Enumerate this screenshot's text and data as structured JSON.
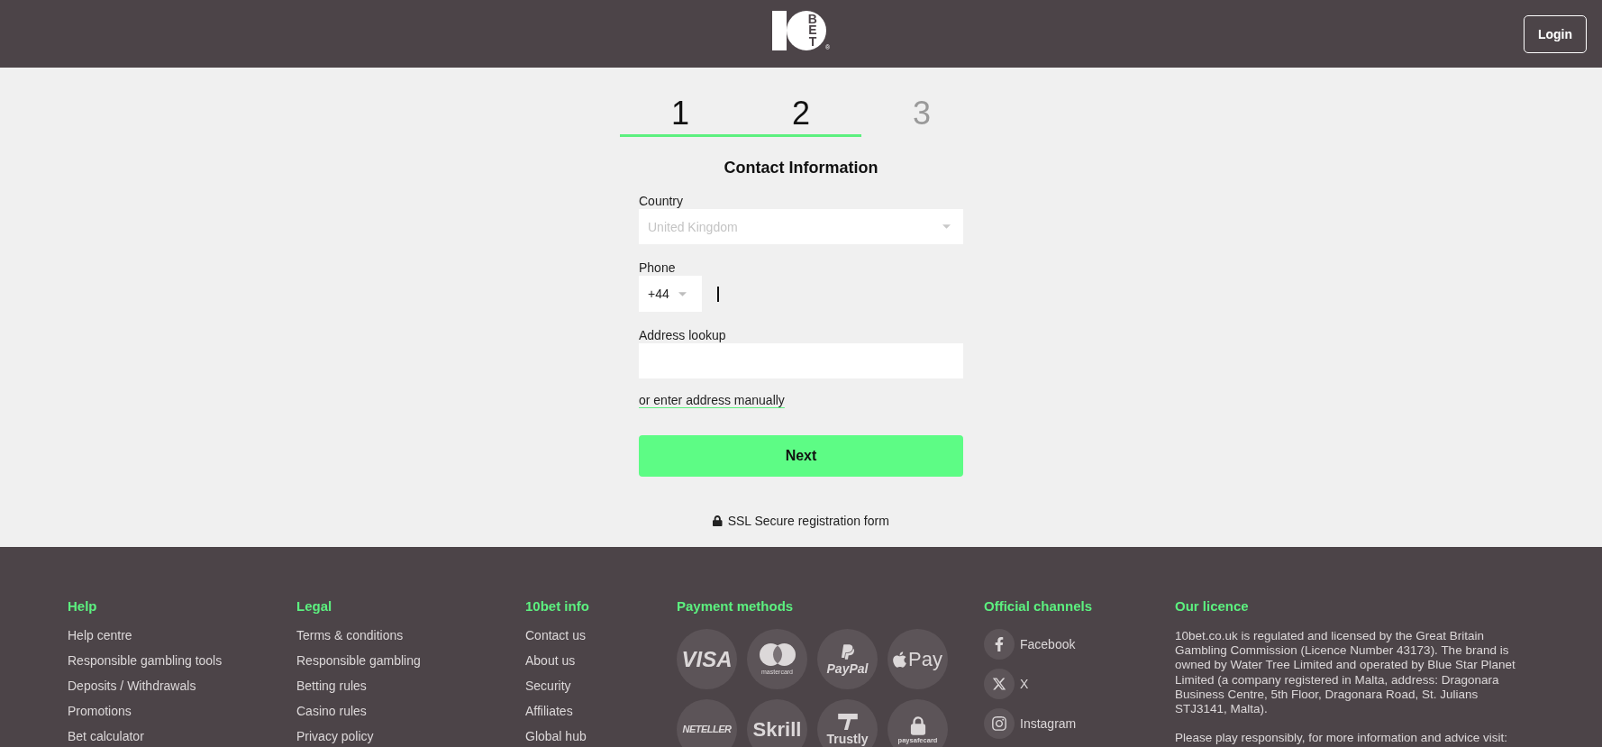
{
  "header": {
    "logo": {
      "text": "BET",
      "mark": "®"
    },
    "login_button": "Login"
  },
  "steps": [
    {
      "label": "1",
      "reached": true
    },
    {
      "label": "2",
      "reached": true
    },
    {
      "label": "3",
      "reached": false
    }
  ],
  "form": {
    "title": "Contact Information",
    "country": {
      "label": "Country",
      "value": "United Kingdom",
      "disabled": true
    },
    "phone": {
      "label": "Phone",
      "prefix": "+44",
      "focused": true
    },
    "address": {
      "label": "Address lookup"
    },
    "manual_link": "or enter address manually",
    "submit_button": "Next",
    "secure_note": "SSL Secure registration form"
  },
  "footer": {
    "link_columns": [
      {
        "heading": "Help",
        "links": [
          "Help centre",
          "Responsible gambling tools",
          "Deposits / Withdrawals",
          "Promotions",
          "Bet calculator"
        ]
      },
      {
        "heading": "Legal",
        "links": [
          "Terms & conditions",
          "Responsible gambling",
          "Betting rules",
          "Casino rules",
          "Privacy policy"
        ]
      },
      {
        "heading": "10bet info",
        "links": [
          "Contact us",
          "About us",
          "Security",
          "Affiliates",
          "Global hub"
        ]
      }
    ],
    "payment_methods": {
      "heading": "Payment methods",
      "items": [
        {
          "label": "VISA",
          "kind": "italic"
        },
        {
          "label": "mastercard",
          "kind": "rings"
        },
        {
          "label": "PayPal",
          "kind": "p-mark"
        },
        {
          "label": "Pay",
          "kind": "apple"
        },
        {
          "label": "NETELLER",
          "kind": "italic"
        },
        {
          "label": "Skrill",
          "kind": "bold"
        },
        {
          "label": "Trustly",
          "kind": "t-mark"
        },
        {
          "label": "paysafecard",
          "kind": "lock"
        }
      ]
    },
    "official_channels": {
      "heading": "Official channels",
      "items": [
        {
          "label": "Facebook",
          "kind": "facebook"
        },
        {
          "label": "X",
          "kind": "x"
        },
        {
          "label": "Instagram",
          "kind": "instagram"
        }
      ]
    },
    "licence": {
      "heading": "Our licence",
      "paragraphs": [
        "10bet.co.uk is regulated and licensed by the Great Britain Gambling Commission (Licence Number 43173). The brand is owned by Water Tree Limited and operated by Blue Star Planet Limited (a company registered in Malta, address: Dragonara Business Centre, 5th Floor, Dragonara Road, St. Julians STJ3141, Malta).",
        "Please play responsibly, for more information and advice visit:"
      ]
    }
  }
}
